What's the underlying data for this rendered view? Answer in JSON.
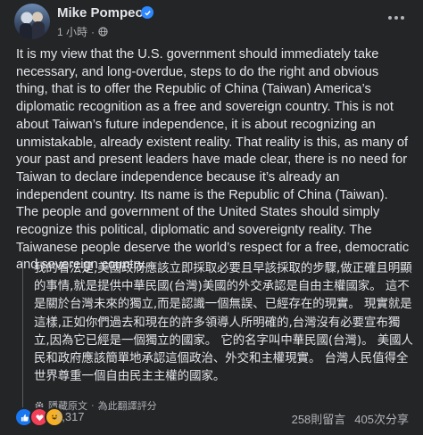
{
  "author": {
    "name": "Mike Pompeo",
    "time": "1 小時",
    "separator": "·"
  },
  "post": {
    "text": "It is my view that the U.S. government should immediately take necessary, and long-overdue, steps to do the right and obvious thing, that is to offer the Republic of China (Taiwan) America’s diplomatic recognition as a free and sovereign country. This is not about Taiwan’s future independence, it is about recognizing an unmistakable, already existent reality. That reality is this, as many of your past and present leaders have made clear, there is no need for Taiwan to declare independence because it’s already an independent country. Its name is the Republic of China (Taiwan). The people and government of the United States should simply recognize this political, diplomatic and sovereignty reality. The Taiwanese people deserve the world’s respect for a free, democratic and sovereign country."
  },
  "translation": {
    "text": "我的看法是,美國政府應該立即採取必要且早該採取的步驟,做正確且明顯的事情,就是提供中華民國(台灣)美國的外交承認是自由主權國家。 這不是關於台灣未來的獨立,而是認識一個無誤、已經存在的現實。 現實就是這樣,正如你們過去和現在的許多領導人所明確的,台灣沒有必要宣布獨立,因為它已經是一個獨立的國家。 它的名字叫中華民國(台灣)。 美國人民和政府應該簡單地承認這個政治、外交和主權現實。 台灣人民值得全世界尊重一個自由民主主權的國家。",
    "hide_link": "隱藏原文",
    "separator": "·",
    "rate_link": "為此翻譯評分"
  },
  "footer": {
    "reaction_count": "3,317",
    "comments": "258則留言",
    "shares": "405次分享"
  },
  "colors": {
    "background": "#242526",
    "text": "#e4e6eb",
    "secondary": "#b0b3b8",
    "verified": "#2d88ff",
    "like": "#1877f2",
    "love": "#f33e58",
    "haha": "#f7b125"
  },
  "icons": [
    "verified-badge-icon",
    "globe-icon",
    "more-options-icon",
    "gear-icon",
    "like-reaction-icon",
    "love-reaction-icon",
    "haha-reaction-icon"
  ]
}
